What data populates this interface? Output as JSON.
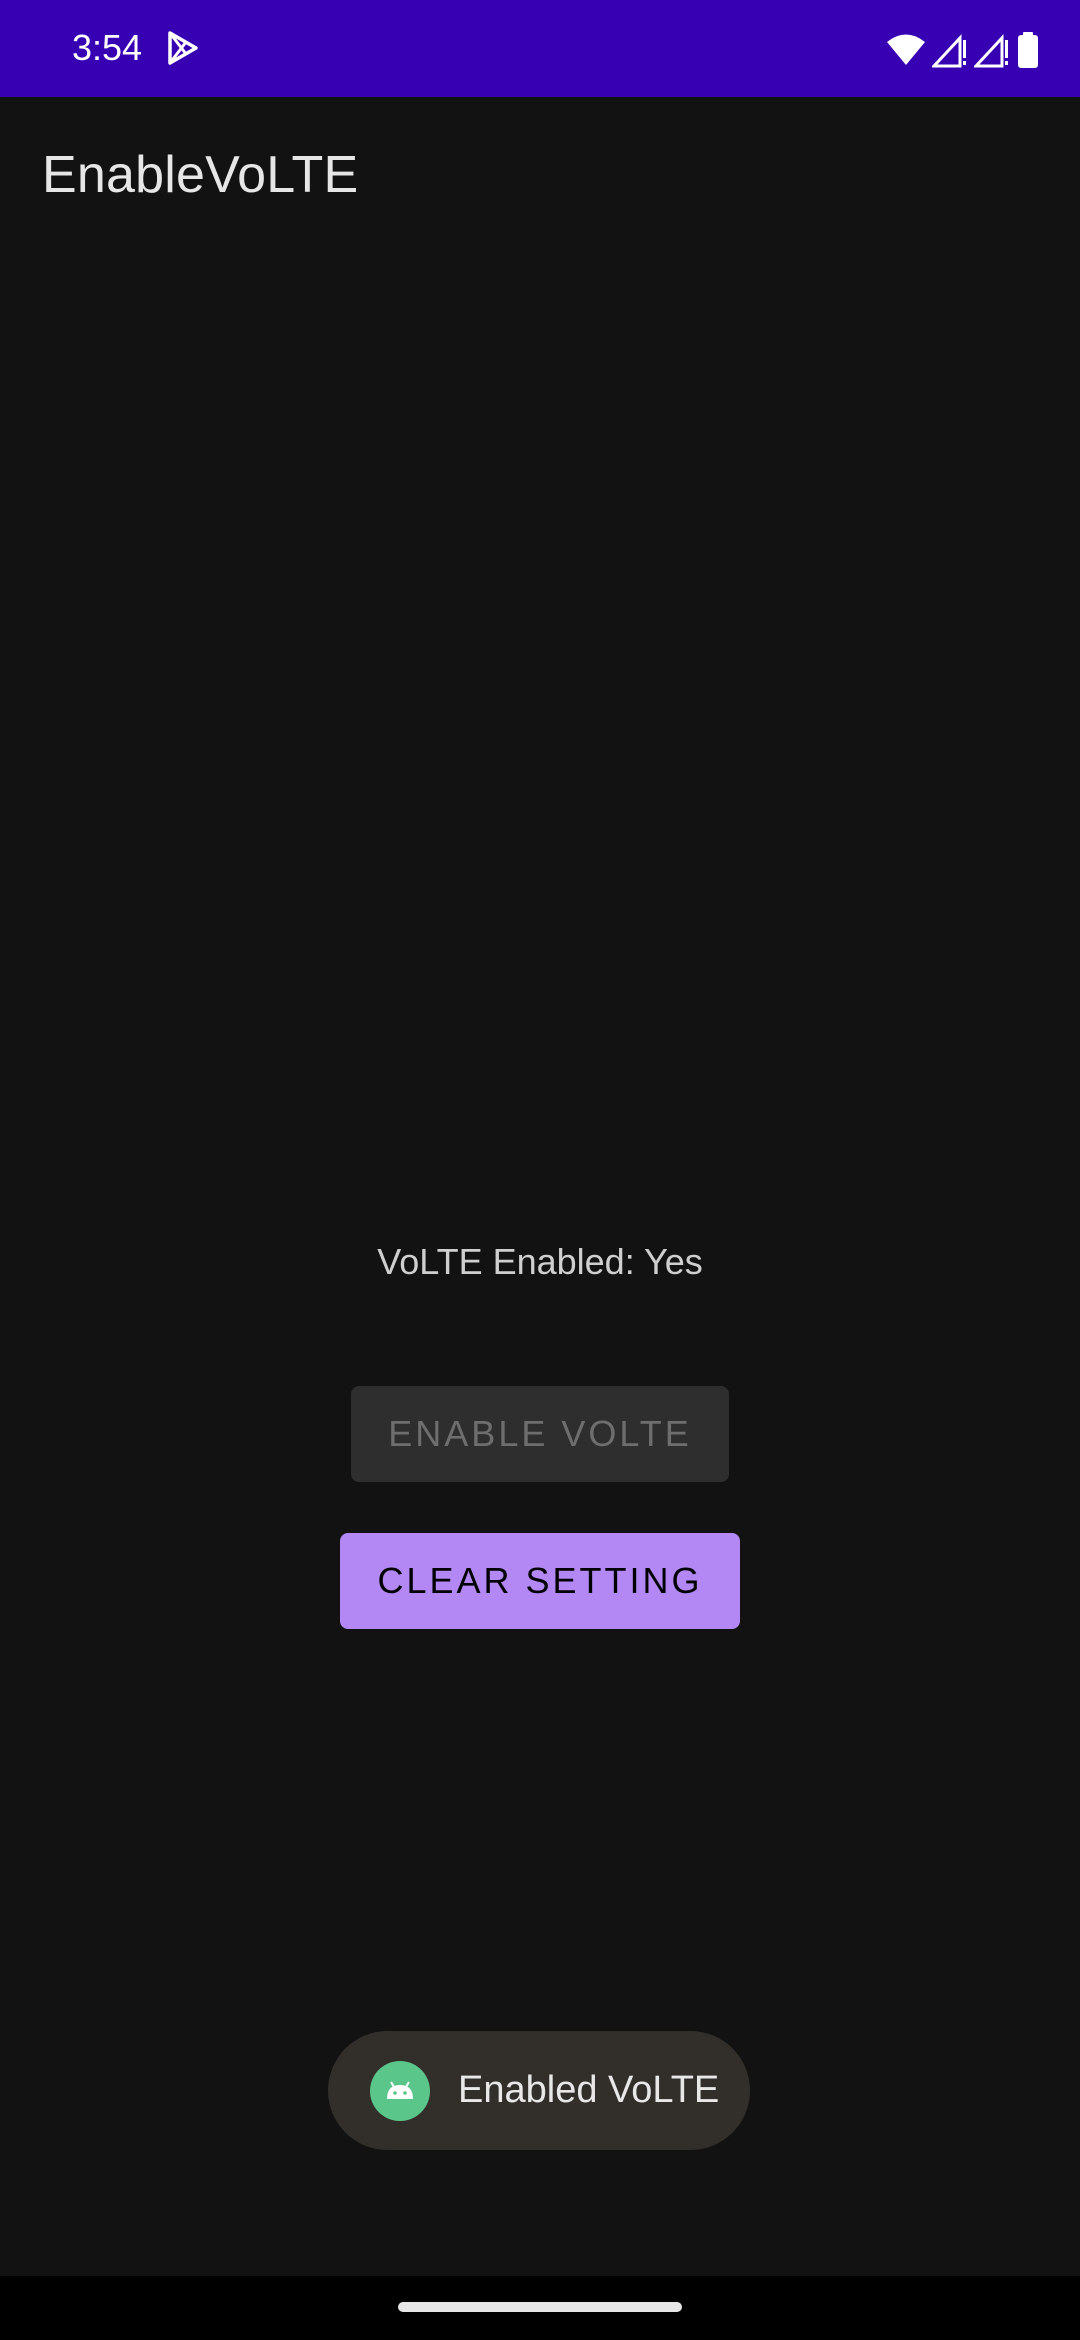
{
  "status_bar": {
    "time": "3:54",
    "icons": [
      "play-store-icon",
      "wifi-icon",
      "signal-icon",
      "signal-icon",
      "battery-icon"
    ]
  },
  "app": {
    "title": "EnableVoLTE"
  },
  "main": {
    "status_text": "VoLTE Enabled: Yes",
    "enable_button_label": "Enable VoLTE",
    "enable_button_enabled": false,
    "clear_button_label": "Clear Setting"
  },
  "toast": {
    "icon": "android-icon",
    "message": "Enabled VoLTE"
  },
  "colors": {
    "status_bar": "#3700b3",
    "background": "#121212",
    "accent": "#b388f4",
    "toast_bg": "#322f2b"
  }
}
